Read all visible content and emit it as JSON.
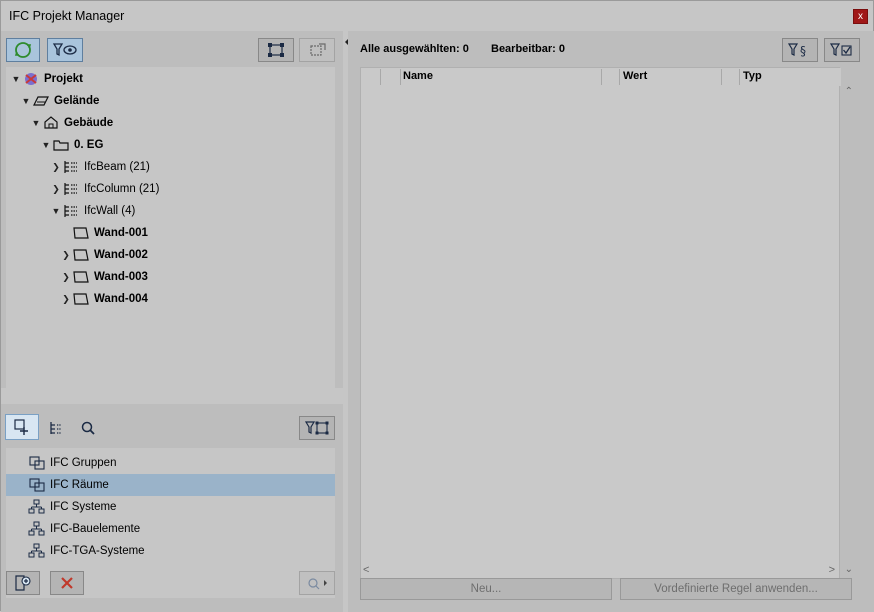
{
  "window": {
    "title": "IFC Projekt Manager",
    "close_label": "x"
  },
  "left_toolbar": {
    "refresh_icon": "refresh-icon",
    "filter_view_icon": "filter-eye-icon",
    "select_frame_icon": "select-frame-icon",
    "move_frame_icon": "move-frame-icon"
  },
  "tree": [
    {
      "label": "Projekt",
      "icon": "project-icon",
      "expanded": true
    },
    {
      "label": "Gelände",
      "icon": "terrain-icon",
      "expanded": true
    },
    {
      "label": "Gebäude",
      "icon": "building-icon",
      "expanded": true
    },
    {
      "label": "0. EG",
      "icon": "storey-icon",
      "expanded": true
    },
    {
      "label": "IfcBeam (21)",
      "icon": "type-list-icon",
      "expanded": false
    },
    {
      "label": "IfcColumn (21)",
      "icon": "type-list-icon",
      "expanded": false
    },
    {
      "label": "IfcWall (4)",
      "icon": "type-list-icon",
      "expanded": true
    },
    {
      "label": "Wand-001",
      "icon": "wall-icon",
      "expanded": null
    },
    {
      "label": "Wand-002",
      "icon": "wall-icon",
      "expanded": false
    },
    {
      "label": "Wand-003",
      "icon": "wall-icon",
      "expanded": false
    },
    {
      "label": "Wand-004",
      "icon": "wall-icon",
      "expanded": false
    }
  ],
  "mid_toolbar": {
    "add_group_icon": "add-group-icon",
    "hierarchy_icon": "hierarchy-icon",
    "search_icon": "search-icon",
    "filter_frame_icon": "filter-frame-icon"
  },
  "groups": [
    {
      "label": "IFC Gruppen",
      "icon": "group-icon",
      "selected": false
    },
    {
      "label": "IFC Räume",
      "icon": "group-icon",
      "selected": true
    },
    {
      "label": "IFC Systeme",
      "icon": "system-icon",
      "selected": false
    },
    {
      "label": "IFC-Bauelemente",
      "icon": "system-icon",
      "selected": false
    },
    {
      "label": "IFC-TGA-Systeme",
      "icon": "system-icon",
      "selected": false
    }
  ],
  "status": {
    "all_selected": "Alle ausgewählten: 0",
    "editable": "Bearbeitbar: 0"
  },
  "table": {
    "columns": [
      "Name",
      "Wert",
      "Typ"
    ]
  },
  "buttons": {
    "new": "Neu...",
    "apply_rule": "Vordefinierte Regel anwenden..."
  },
  "colors": {
    "background": "#c6c6c6",
    "selected_row": "#9ab3c9",
    "active_button": "#a9c4dc",
    "close_button": "#a01818",
    "delete_icon": "#c0392b"
  }
}
